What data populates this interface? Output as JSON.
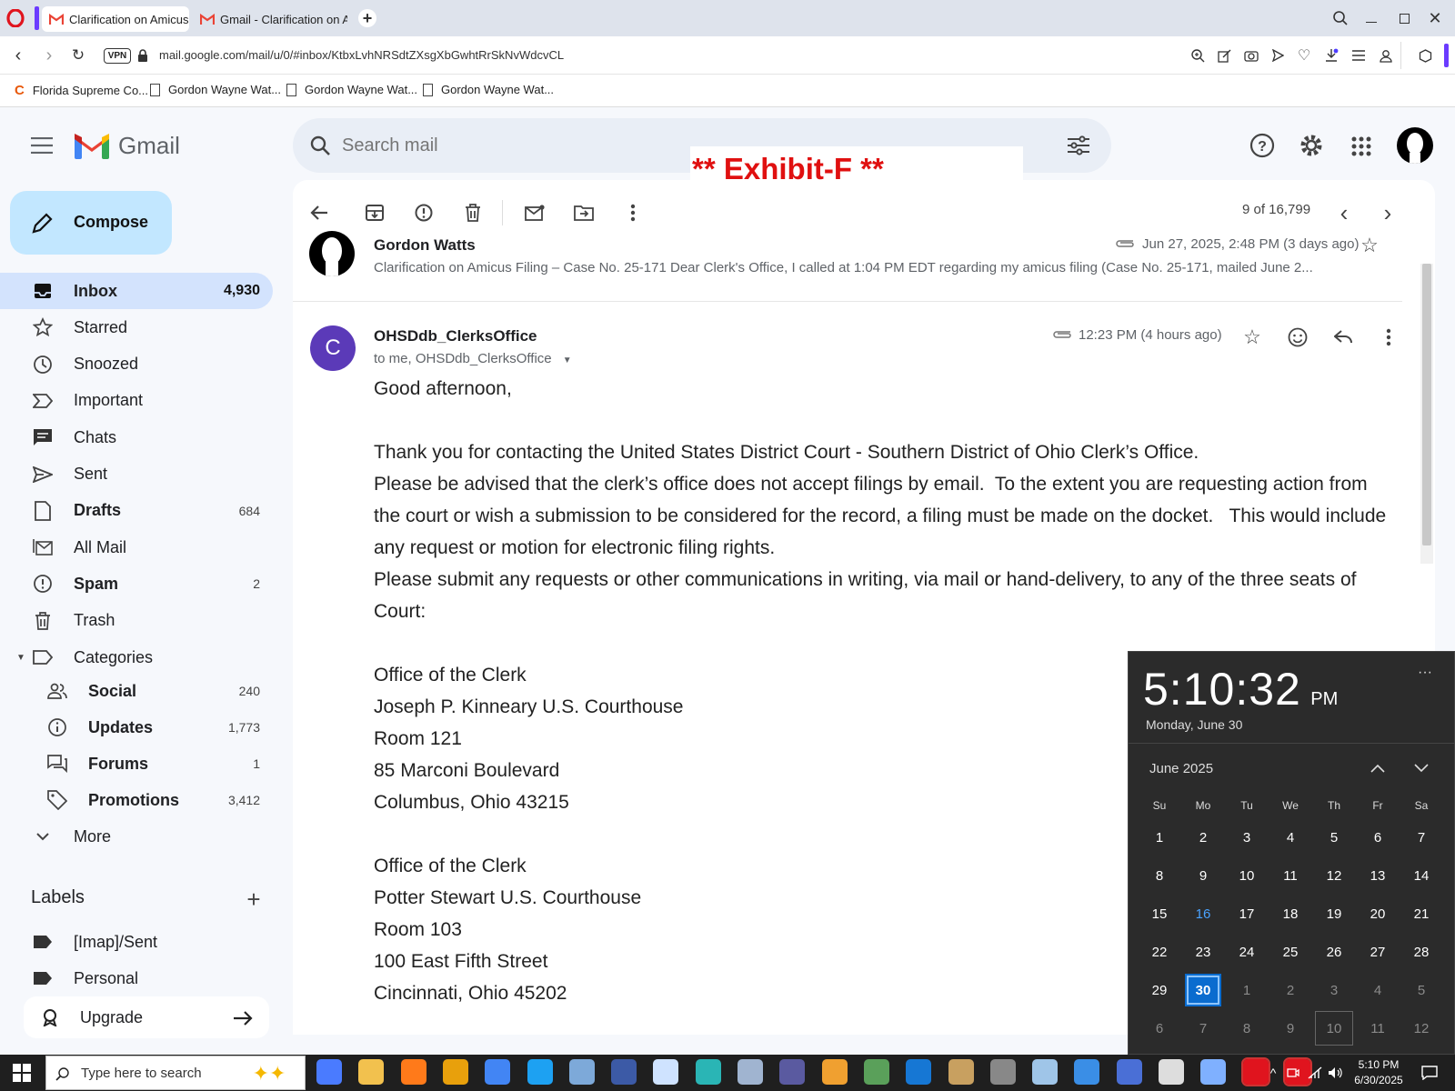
{
  "browser": {
    "tabs": [
      {
        "title": "Clarification on Amicus Fil",
        "active": true
      },
      {
        "title": "Gmail - Clarification on Ar",
        "active": false
      }
    ],
    "vpn_label": "VPN",
    "url": "mail.google.com/mail/u/0/#inbox/KtbxLvhNRSdtZXsgXbGwhtRrSkNvWdcvCL",
    "bookmarks": [
      "Florida Supreme Co...",
      "Gordon Wayne Wat...",
      "Gordon Wayne Wat...",
      "Gordon Wayne Wat..."
    ]
  },
  "gmail": {
    "logo_text": "Gmail",
    "search_placeholder": "Search mail",
    "overlay_label": "** Exhibit-F **",
    "compose_label": "Compose",
    "nav": [
      {
        "label": "Inbox",
        "count": "4,930",
        "bold": true
      },
      {
        "label": "Starred",
        "count": "",
        "bold": false
      },
      {
        "label": "Snoozed",
        "count": "",
        "bold": false
      },
      {
        "label": "Important",
        "count": "",
        "bold": false
      },
      {
        "label": "Chats",
        "count": "",
        "bold": false
      },
      {
        "label": "Sent",
        "count": "",
        "bold": false
      },
      {
        "label": "Drafts",
        "count": "684",
        "bold": true
      },
      {
        "label": "All Mail",
        "count": "",
        "bold": false
      },
      {
        "label": "Spam",
        "count": "2",
        "bold": true
      },
      {
        "label": "Trash",
        "count": "",
        "bold": false
      },
      {
        "label": "Categories",
        "count": "",
        "bold": false
      }
    ],
    "categories": [
      {
        "label": "Social",
        "count": "240"
      },
      {
        "label": "Updates",
        "count": "1,773"
      },
      {
        "label": "Forums",
        "count": "1"
      },
      {
        "label": "Promotions",
        "count": "3,412"
      }
    ],
    "more_label": "More",
    "labels_heading": "Labels",
    "labels": [
      "[Imap]/Sent",
      "Personal"
    ],
    "upgrade_label": "Upgrade",
    "pager": "9 of 16,799"
  },
  "thread": {
    "collapsed": {
      "sender": "Gordon Watts",
      "date": "Jun 27, 2025, 2:48 PM (3 days ago)",
      "snippet": "Clarification on Amicus Filing – Case No. 25-171 Dear Clerk's Office, I called at 1:04 PM EDT regarding my amicus filing (Case No. 25-171, mailed June 2..."
    },
    "open": {
      "avatar_letter": "C",
      "sender": "OHSDdb_ClerksOffice",
      "to": "to me, OHSDdb_ClerksOffice",
      "time": "12:23 PM (4 hours ago)",
      "body": [
        "Good afternoon,",
        "",
        "Thank you for contacting the United States District Court - Southern District of Ohio Clerk’s Office.",
        "Please be advised that the clerk’s office does not accept filings by email.  To the extent you are requesting action from the court or wish a submission to be considered for the record, a filing must be made on the docket.   This would include any request or motion for electronic filing rights.",
        "Please submit any requests or other communications in writing, via mail or hand-delivery, to any of the three seats of Court:",
        "",
        "Office of the Clerk",
        "Joseph P. Kinneary U.S. Courthouse",
        "Room 121",
        "85 Marconi Boulevard",
        "Columbus, Ohio 43215",
        "",
        "Office of the Clerk",
        "Potter Stewart U.S. Courthouse",
        "Room 103",
        "100 East Fifth Street",
        "Cincinnati, Ohio 45202"
      ]
    }
  },
  "clock": {
    "time": "5:10:32",
    "ampm": "PM",
    "date": "Monday, June 30",
    "month": "June 2025",
    "weekdays": [
      "Su",
      "Mo",
      "Tu",
      "We",
      "Th",
      "Fr",
      "Sa"
    ],
    "days": [
      "1",
      "2",
      "3",
      "4",
      "5",
      "6",
      "7",
      "8",
      "9",
      "10",
      "11",
      "12",
      "13",
      "14",
      "15",
      "16",
      "17",
      "18",
      "19",
      "20",
      "21",
      "22",
      "23",
      "24",
      "25",
      "26",
      "27",
      "28",
      "29",
      "30",
      "1",
      "2",
      "3",
      "4",
      "5",
      "6",
      "7",
      "8",
      "9",
      "10",
      "11",
      "12"
    ],
    "selected": "30",
    "today_highlight": "16"
  },
  "taskbar": {
    "search_placeholder": "Type here to search",
    "time": "5:10 PM",
    "date": "6/30/2025"
  }
}
